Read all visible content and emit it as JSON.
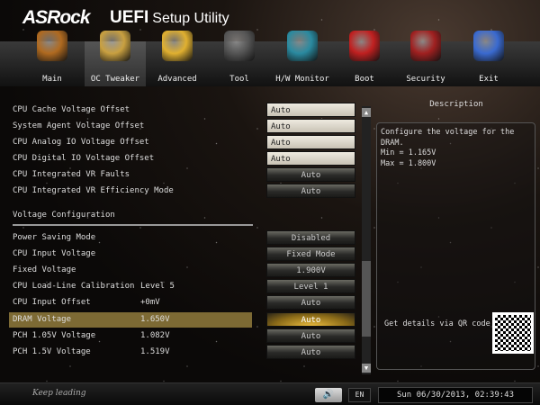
{
  "header": {
    "brand": "ASRock",
    "title_bold": "UEFI",
    "title_rest": "Setup Utility"
  },
  "tabs": [
    {
      "label": "Main",
      "color": "#b06a20"
    },
    {
      "label": "OC Tweaker",
      "color": "#c9a040"
    },
    {
      "label": "Advanced",
      "color": "#e0b030"
    },
    {
      "label": "Tool",
      "color": "#555555"
    },
    {
      "label": "H/W Monitor",
      "color": "#2a8aa0"
    },
    {
      "label": "Boot",
      "color": "#c02020"
    },
    {
      "label": "Security",
      "color": "#a02020"
    },
    {
      "label": "Exit",
      "color": "#3a6ad0"
    }
  ],
  "active_tab": "OC Tweaker",
  "settings_top": [
    {
      "label": "CPU Cache Voltage Offset",
      "option": "Auto",
      "style": "light"
    },
    {
      "label": "System Agent Voltage Offset",
      "option": "Auto",
      "style": "light"
    },
    {
      "label": "CPU Analog IO Voltage Offset",
      "option": "Auto",
      "style": "light"
    },
    {
      "label": "CPU Digital IO Voltage Offset",
      "option": "Auto",
      "style": "light"
    },
    {
      "label": "CPU Integrated VR Faults",
      "option": "Auto",
      "style": "dark"
    },
    {
      "label": "CPU Integrated VR Efficiency Mode",
      "option": "Auto",
      "style": "dark"
    }
  ],
  "section_title": "Voltage Configuration",
  "settings_voltage": [
    {
      "label": "Power Saving Mode",
      "value": "",
      "option": "Disabled"
    },
    {
      "label": "CPU Input Voltage",
      "value": "",
      "option": "Fixed Mode"
    },
    {
      "label": " Fixed Voltage",
      "value": "",
      "option": "1.900V"
    },
    {
      "label": "CPU Load-Line Calibration",
      "value": "Level 5",
      "option": "Level 1"
    },
    {
      "label": "CPU Input Offset",
      "value": "+0mV",
      "option": "Auto"
    },
    {
      "label": "DRAM Voltage",
      "value": "1.650V",
      "option": "Auto",
      "selected": true
    },
    {
      "label": "PCH 1.05V Voltage",
      "value": "1.082V",
      "option": "Auto"
    },
    {
      "label": "PCH 1.5V Voltage",
      "value": "1.519V",
      "option": "Auto"
    }
  ],
  "scrollbar": {
    "position_fraction": 0.85
  },
  "description": {
    "heading": "Description",
    "lines": [
      "Configure the voltage for the DRAM.",
      "Min = 1.165V",
      "Max = 1.800V"
    ],
    "qr_text": "Get details via QR code"
  },
  "footer": {
    "slogan": "Keep leading",
    "language": "EN",
    "datetime": "Sun 06/30/2013, 02:39:43"
  }
}
